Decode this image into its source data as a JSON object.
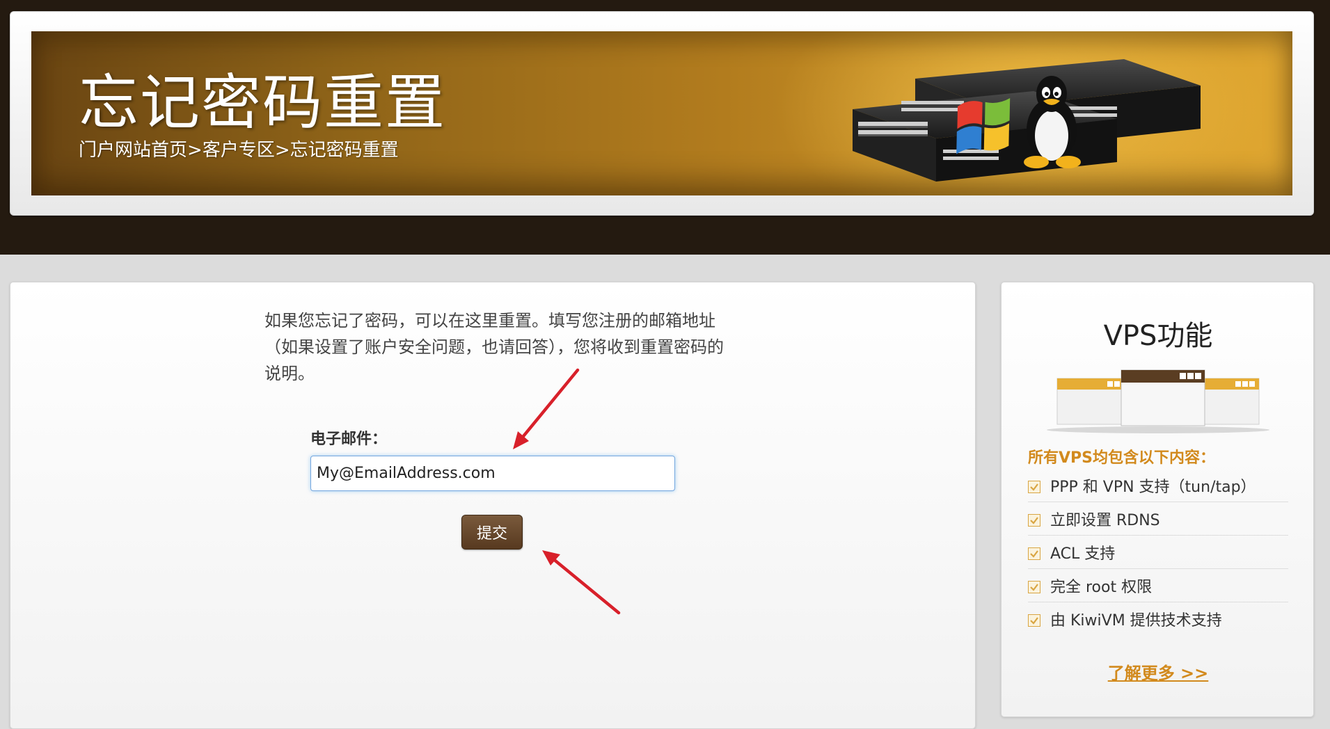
{
  "header": {
    "title": "忘记密码重置",
    "breadcrumb": {
      "home": "门户网站首页",
      "separator": ">",
      "client_area": "客户专区",
      "current": "忘记密码重置"
    }
  },
  "form": {
    "intro_text": "如果您忘记了密码，可以在这里重置。填写您注册的邮箱地址（如果设置了账户安全问题，也请回答），您将收到重置密码的说明。",
    "email_label": "电子邮件：",
    "email_value": "My@EmailAddress.com",
    "submit_label": "提交"
  },
  "sidebar": {
    "title": "VPS功能",
    "subtitle": "所有VPS均包含以下内容：",
    "features": [
      "PPP 和 VPN 支持（tun/tap）",
      "立即设置 RDNS",
      "ACL 支持",
      "完全 root 权限",
      "由 KiwiVM 提供技术支持"
    ],
    "learn_more": "了解更多 >>"
  },
  "colors": {
    "header_bg": "#241a10",
    "banner_gold": "#e0a731",
    "accent": "#d28a1d",
    "button": "#57391f",
    "annotation_arrow": "#d8202a"
  },
  "icons": {
    "feature_check": "checkbox-checked-icon",
    "annotation": "red-arrow-icon"
  }
}
